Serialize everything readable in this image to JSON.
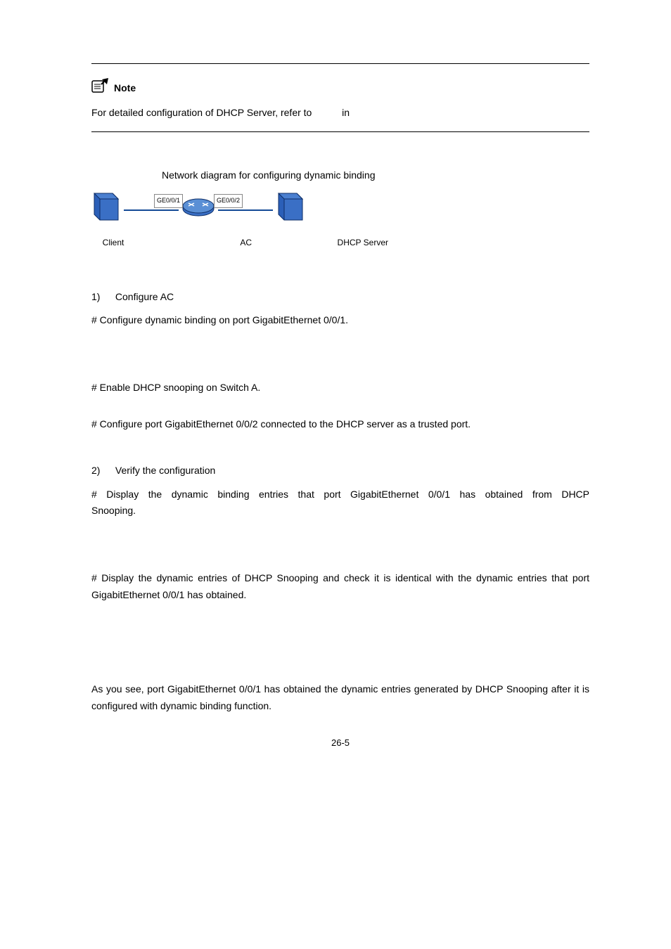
{
  "note": {
    "label": "Note",
    "text_a": "For detailed configuration of DHCP Server, refer to",
    "text_b": "in"
  },
  "figure": {
    "caption": "Network diagram for configuring dynamic binding",
    "port1": "GE0/0/1",
    "port2": "GE0/0/2",
    "label_client": "Client",
    "label_ac": "AC",
    "label_server": "DHCP Server"
  },
  "body": {
    "s1_num": "1)",
    "s1_text": "Configure AC",
    "s1_desc": "# Configure dynamic binding on port GigabitEthernet 0/0/1.",
    "s2": "# Enable DHCP snooping on Switch A.",
    "s3": "# Configure port GigabitEthernet 0/0/2 connected to the DHCP server as a trusted port.",
    "s4_num": "2)",
    "s4_text": "Verify the configuration",
    "s4_desc": "# Display the dynamic binding entries that port GigabitEthernet 0/0/1 has obtained from DHCP Snooping.",
    "s5": "# Display the dynamic entries of DHCP Snooping and check it is identical with the dynamic entries that port GigabitEthernet 0/0/1 has obtained.",
    "s6": "As you see, port GigabitEthernet 0/0/1 has obtained the dynamic entries generated by DHCP Snooping after it is configured with dynamic binding function."
  },
  "page_number": "26-5"
}
